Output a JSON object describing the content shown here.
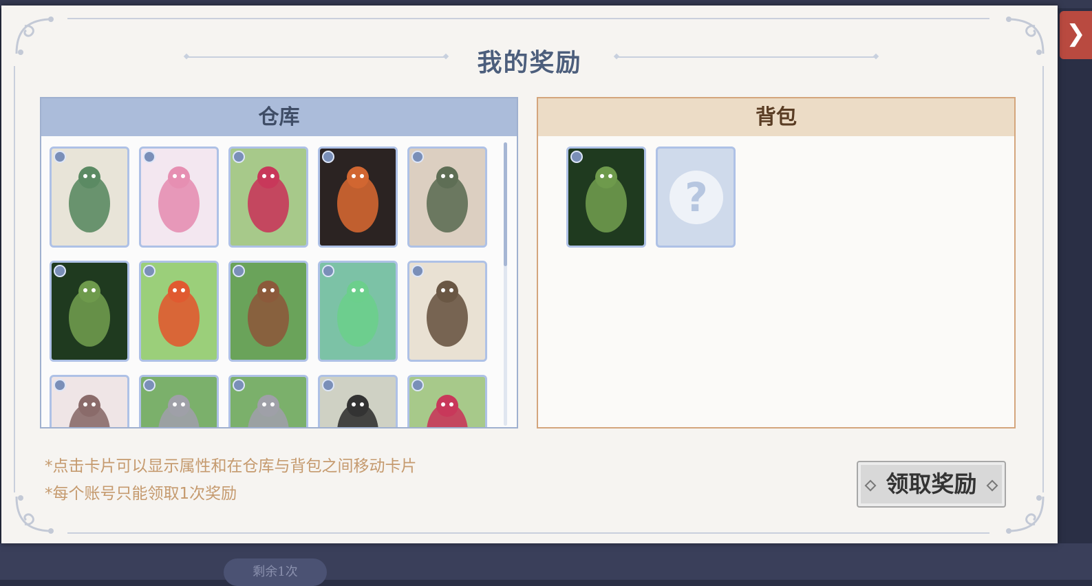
{
  "dialog": {
    "title": "我的奖励",
    "close_icon": "chevron-right-icon"
  },
  "background": {
    "pill_text": "剩余1次"
  },
  "storage": {
    "label": "仓库",
    "cards": [
      {
        "art": "green-beetle-boxer",
        "bg": "#e8e4d8",
        "fg": "#5b8a63"
      },
      {
        "art": "fairy-flower",
        "bg": "#f3e7f0",
        "fg": "#e68fb2"
      },
      {
        "art": "pink-moth",
        "bg": "#a7c98a",
        "fg": "#c8385a"
      },
      {
        "art": "orange-spider",
        "bg": "#2b2322",
        "fg": "#d16631"
      },
      {
        "art": "robot-soldier",
        "bg": "#dccfc1",
        "fg": "#5e6e55"
      },
      {
        "art": "mantis",
        "bg": "#1f3a1f",
        "fg": "#6e9a4c"
      },
      {
        "art": "boy-backpack",
        "bg": "#9bcf7a",
        "fg": "#e05a30"
      },
      {
        "art": "tree-stump",
        "bg": "#6aa35a",
        "fg": "#8c5a3b"
      },
      {
        "art": "green-creature",
        "bg": "#7cc2a6",
        "fg": "#6ccf8c"
      },
      {
        "art": "mosquito",
        "bg": "#e9e1d3",
        "fg": "#6a5744"
      },
      {
        "art": "skeleton-figure",
        "bg": "#efe5e6",
        "fg": "#8a6b6a"
      },
      {
        "art": "raccoon",
        "bg": "#7bb06b",
        "fg": "#9fa0a8"
      },
      {
        "art": "raccoon",
        "bg": "#7bb06b",
        "fg": "#9fa0a8"
      },
      {
        "art": "ninja",
        "bg": "#cfd1c4",
        "fg": "#333333"
      },
      {
        "art": "pink-moth",
        "bg": "#a7c98a",
        "fg": "#c8385a"
      }
    ]
  },
  "backpack": {
    "label": "背包",
    "cards": [
      {
        "art": "mantis",
        "bg": "#1f3a1f",
        "fg": "#6e9a4c"
      }
    ],
    "empty_slot_symbol": "?"
  },
  "notes": [
    "*点击卡片可以显示属性和在仓库与背包之间移动卡片",
    "*每个账号只能领取1次奖励"
  ],
  "claim_button_label": "领取奖励"
}
